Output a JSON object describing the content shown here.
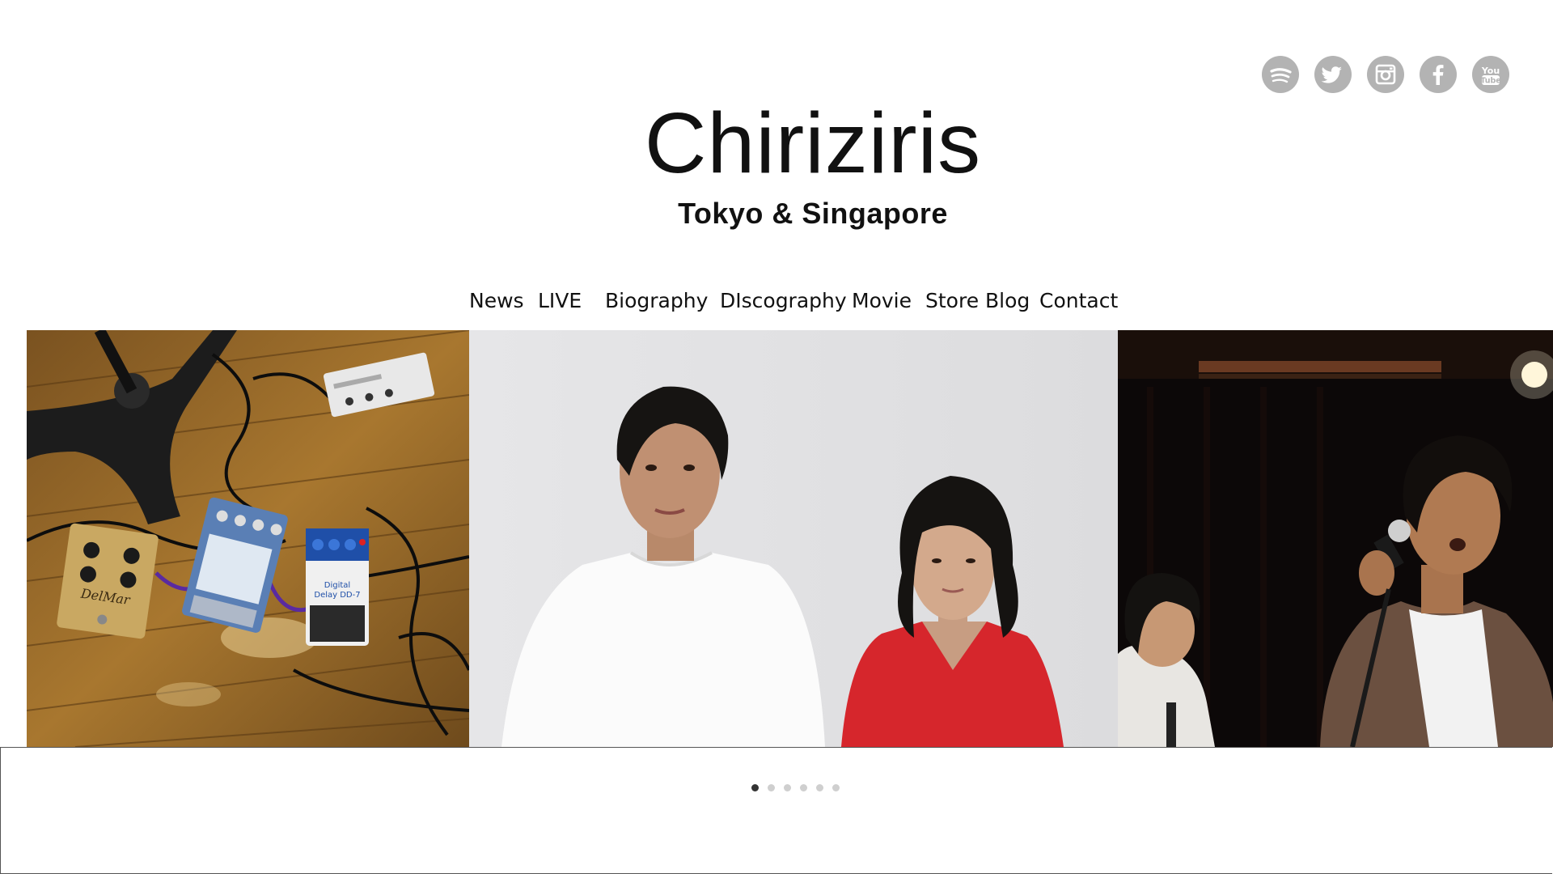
{
  "site": {
    "title": "Chiriziris",
    "subtitle": "Tokyo & Singapore"
  },
  "social": [
    {
      "name": "spotify",
      "icon": "spotify-icon"
    },
    {
      "name": "twitter",
      "icon": "twitter-icon"
    },
    {
      "name": "instagram",
      "icon": "instagram-icon"
    },
    {
      "name": "facebook",
      "icon": "facebook-icon"
    },
    {
      "name": "youtube",
      "icon": "youtube-icon",
      "label": "You Tube"
    }
  ],
  "nav": {
    "items": [
      {
        "label": "News"
      },
      {
        "label": "LIVE"
      },
      {
        "label": "Biography"
      },
      {
        "label": "DIscography"
      },
      {
        "label": "Movie"
      },
      {
        "label": "Store"
      },
      {
        "label": "Blog"
      },
      {
        "label": "Contact"
      }
    ]
  },
  "carousel": {
    "slides": [
      {
        "name": "effects-pedals-photo"
      },
      {
        "name": "band-portrait-photo"
      },
      {
        "name": "live-performance-photo"
      }
    ],
    "dots": 6,
    "active_dot": 0
  },
  "colors": {
    "social_icon_bg": "#b3b3b3",
    "text": "#111111",
    "dot_active": "#333333",
    "dot_inactive": "#cfcfcf"
  }
}
